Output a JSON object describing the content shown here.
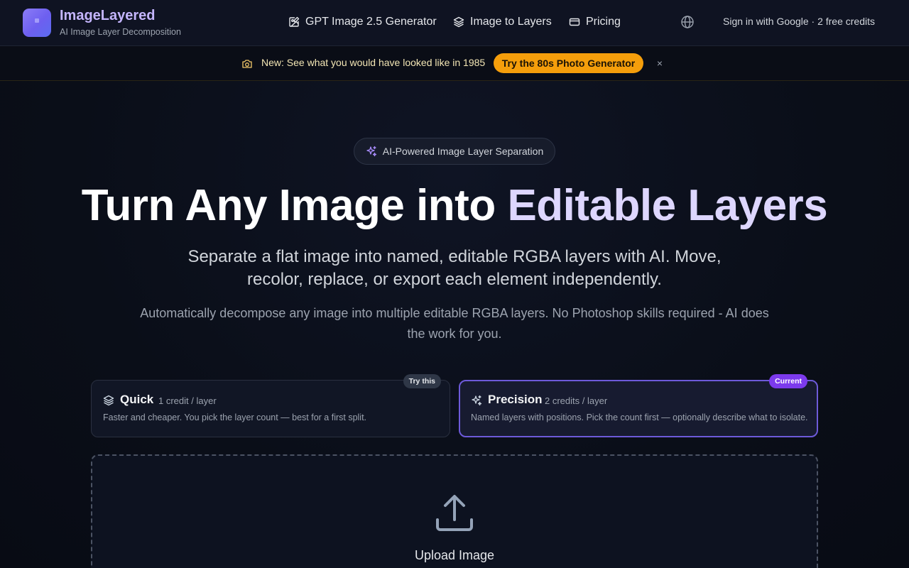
{
  "header": {
    "brand_title": "ImageLayered",
    "brand_subtitle": "AI Image Layer Decomposition",
    "nav": [
      {
        "label": "GPT Image 2.5 Generator",
        "icon": "image-edit-icon"
      },
      {
        "label": "Image to Layers",
        "icon": "layers-icon"
      },
      {
        "label": "Pricing",
        "icon": "credit-card-icon"
      }
    ],
    "language_icon": "globe-icon",
    "signin_label": "Sign in with Google · 2 free credits"
  },
  "banner": {
    "icon": "camera-icon",
    "text": "New: See what you would have looked like in 1985",
    "cta_label": "Try the 80s Photo Generator",
    "close_glyph": "×"
  },
  "hero": {
    "pill_label": "AI-Powered Image Layer Separation",
    "title_main": "Turn Any Image into ",
    "title_accent": "Editable Layers",
    "subtitle": "Separate a flat image into named, editable RGBA layers with AI. Move, recolor, replace, or export each element independently.",
    "description": "Automatically decompose any image into multiple editable RGBA layers. No Photoshop skills required - AI does the work for you."
  },
  "modes": [
    {
      "name": "Quick",
      "cost": "1 credit / layer",
      "description": "Faster and cheaper. You pick the layer count — best for a first split.",
      "badge": "Try this",
      "selected": false
    },
    {
      "name": "Precision",
      "cost": "2 credits / layer",
      "description": "Named layers with positions. Pick the count first — optionally describe what to isolate.",
      "badge": "Current",
      "selected": true
    }
  ],
  "upload": {
    "label": "Upload Image",
    "icon": "upload-icon"
  },
  "colors": {
    "accent": "#7c3aed",
    "banner_cta": "#f59e0b",
    "brand": "#c4b5fd",
    "background": "#0b0f1a"
  }
}
